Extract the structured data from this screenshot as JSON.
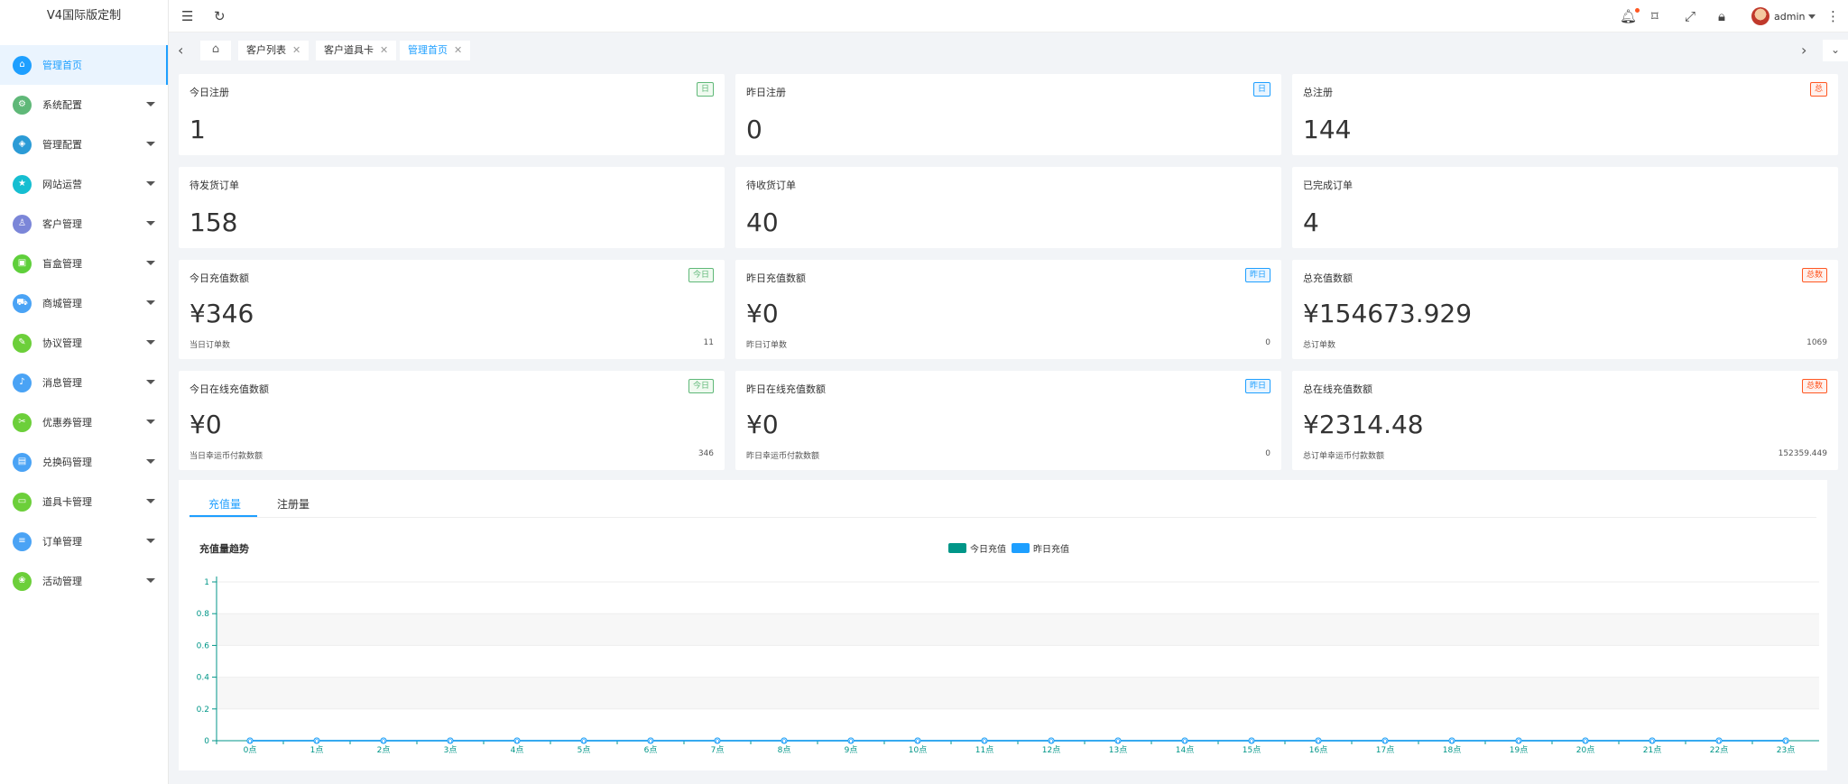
{
  "app": {
    "title": "V4国际版定制"
  },
  "sidebar": {
    "items": [
      {
        "label": "管理首页",
        "icon": "home-icon",
        "color": "#1e9fff",
        "glyph": "⌂",
        "active": true,
        "arrow": false
      },
      {
        "label": "系统配置",
        "icon": "gear-icon",
        "color": "#5fb878",
        "glyph": "⚙",
        "active": false,
        "arrow": true
      },
      {
        "label": "管理配置",
        "icon": "shield-icon",
        "color": "#2b9bd6",
        "glyph": "◈",
        "active": false,
        "arrow": true
      },
      {
        "label": "网站运营",
        "icon": "star-icon",
        "color": "#16bed1",
        "glyph": "★",
        "active": false,
        "arrow": true
      },
      {
        "label": "客户管理",
        "icon": "user-icon",
        "color": "#7b86d8",
        "glyph": "♙",
        "active": false,
        "arrow": true
      },
      {
        "label": "盲盒管理",
        "icon": "box-icon",
        "color": "#5fcf3b",
        "glyph": "▣",
        "active": false,
        "arrow": true
      },
      {
        "label": "商城管理",
        "icon": "cart-icon",
        "color": "#4aa3f5",
        "glyph": "⛟",
        "active": false,
        "arrow": true
      },
      {
        "label": "协议管理",
        "icon": "document-icon",
        "color": "#6ccf3a",
        "glyph": "✎",
        "active": false,
        "arrow": true
      },
      {
        "label": "消息管理",
        "icon": "bell-icon",
        "color": "#4aa3f5",
        "glyph": "♪",
        "active": false,
        "arrow": true
      },
      {
        "label": "优惠券管理",
        "icon": "coupon-icon",
        "color": "#6ccf3a",
        "glyph": "✂",
        "active": false,
        "arrow": true
      },
      {
        "label": "兑换码管理",
        "icon": "calendar-icon",
        "color": "#4aa3f5",
        "glyph": "▤",
        "active": false,
        "arrow": true
      },
      {
        "label": "道具卡管理",
        "icon": "card-icon",
        "color": "#6ccf3a",
        "glyph": "▭",
        "active": false,
        "arrow": true
      },
      {
        "label": "订单管理",
        "icon": "list-icon",
        "color": "#4aa3f5",
        "glyph": "≡",
        "active": false,
        "arrow": true
      },
      {
        "label": "活动管理",
        "icon": "activity-icon",
        "color": "#6ccf3a",
        "glyph": "❀",
        "active": false,
        "arrow": true
      }
    ]
  },
  "header": {
    "user_name": "admin",
    "icons": [
      "menu-toggle-icon",
      "refresh-icon",
      "bell-icon",
      "tag-icon",
      "fullscreen-icon",
      "lock-icon",
      "more-icon"
    ]
  },
  "tabs": [
    {
      "label": "客户列表",
      "active": false
    },
    {
      "label": "客户道具卡",
      "active": false
    },
    {
      "label": "管理首页",
      "active": true
    }
  ],
  "stats_row1": [
    {
      "title": "今日注册",
      "badge": "日",
      "badge_color": "blue",
      "value": "1"
    },
    {
      "title": "昨日注册",
      "badge": "日",
      "badge_color": "blue",
      "value": "0"
    },
    {
      "title": "总注册",
      "badge": "总",
      "badge_color": "red",
      "value": "144"
    }
  ],
  "stats_row1_badge_colors": [
    "green",
    "blue",
    "red"
  ],
  "stats_row2": [
    {
      "title": "待发货订单",
      "value": "158"
    },
    {
      "title": "待收货订单",
      "value": "40"
    },
    {
      "title": "已完成订单",
      "value": "4"
    }
  ],
  "stats_row3": [
    {
      "title": "今日充值数额",
      "badge": "今日",
      "badge_color": "green",
      "value": "¥346",
      "foot_label": "当日订单数",
      "foot_value": "11"
    },
    {
      "title": "昨日充值数额",
      "badge": "昨日",
      "badge_color": "blue",
      "value": "¥0",
      "foot_label": "昨日订单数",
      "foot_value": "0"
    },
    {
      "title": "总充值数额",
      "badge": "总数",
      "badge_color": "red",
      "value": "¥154673.929",
      "foot_label": "总订单数",
      "foot_value": "1069"
    }
  ],
  "stats_row4": [
    {
      "title": "今日在线充值数额",
      "badge": "今日",
      "badge_color": "green",
      "value": "¥0",
      "foot_label": "当日幸运币付款数额",
      "foot_value": "346"
    },
    {
      "title": "昨日在线充值数额",
      "badge": "昨日",
      "badge_color": "blue",
      "value": "¥0",
      "foot_label": "昨日幸运币付款数额",
      "foot_value": "0"
    },
    {
      "title": "总在线充值数额",
      "badge": "总数",
      "badge_color": "red",
      "value": "¥2314.48",
      "foot_label": "总订单幸运币付款数额",
      "foot_value": "152359.449"
    }
  ],
  "chart_tabs": [
    {
      "label": "充值量",
      "active": true
    },
    {
      "label": "注册量",
      "active": false
    }
  ],
  "chart_data": {
    "type": "line",
    "title": "充值量趋势",
    "categories": [
      "0点",
      "1点",
      "2点",
      "3点",
      "4点",
      "5点",
      "6点",
      "7点",
      "8点",
      "9点",
      "10点",
      "11点",
      "12点",
      "13点",
      "14点",
      "15点",
      "16点",
      "17点",
      "18点",
      "19点",
      "20点",
      "21点",
      "22点",
      "23点"
    ],
    "series": [
      {
        "name": "今日充值",
        "color": "#009688",
        "values": [
          0,
          0,
          0,
          0,
          0,
          0,
          0,
          0,
          0,
          0,
          0,
          0,
          0,
          0,
          0,
          0,
          0,
          0,
          0,
          0,
          0,
          0,
          0,
          0
        ]
      },
      {
        "name": "昨日充值",
        "color": "#1e9fff",
        "values": [
          0,
          0,
          0,
          0,
          0,
          0,
          0,
          0,
          0,
          0,
          0,
          0,
          0,
          0,
          0,
          0,
          0,
          0,
          0,
          0,
          0,
          0,
          0,
          0
        ]
      }
    ],
    "yticks": [
      "0",
      "0.2",
      "0.4",
      "0.6",
      "0.8",
      "1"
    ],
    "ylim": [
      0,
      1
    ],
    "point_labels": "0",
    "grid": true,
    "legend": "top-center"
  }
}
